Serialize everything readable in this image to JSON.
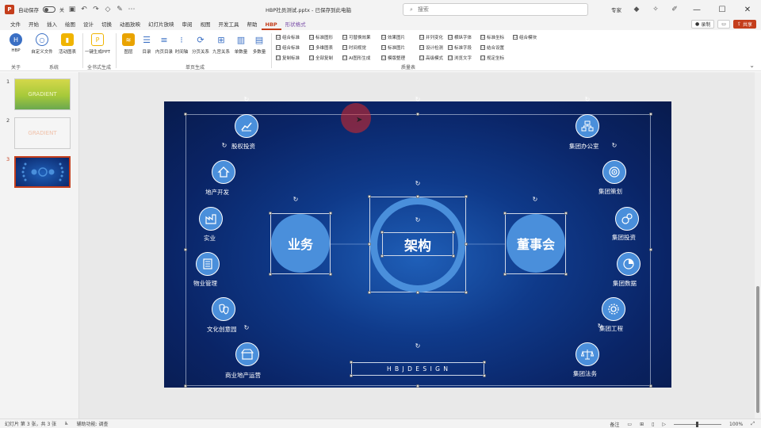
{
  "titlebar": {
    "autosave_label": "自动保存",
    "autosave_state": "关",
    "file_title": "HBP社员测试.pptx - 已保存到此电脑",
    "search_placeholder": "搜索",
    "user": "专家",
    "minimize": "—",
    "maximize": "☐",
    "close": "✕"
  },
  "menu": {
    "tabs": [
      "文件",
      "开始",
      "插入",
      "绘图",
      "设计",
      "切换",
      "动画放映",
      "幻灯片放映",
      "审阅",
      "视图",
      "开发工具",
      "帮助",
      "HBP",
      "形状格式"
    ],
    "active_index": 12,
    "context_index": 13,
    "record_label": "录制",
    "comment_icon": "comment-icon",
    "share_label": "共享"
  },
  "ribbon": {
    "groups": {
      "about": "关于",
      "tools": "系统",
      "generate": "全书式生成",
      "single": "单页生成",
      "checklist": "质量表"
    },
    "buttons": {
      "hbp": "HBP",
      "comment": "自定义文件",
      "inherit": "活动图表",
      "one_click": "一键生成PPT",
      "layer": "图层",
      "list": "目录",
      "list2": "内页目录",
      "cycle": "时间轴",
      "group": "分页关系",
      "grid": "九宫关系",
      "word": "单数量",
      "table": "多数量"
    },
    "checks": [
      "组合标准",
      "标准图形",
      "可替换效果",
      "效果图片",
      "并列变化",
      "横纵字体",
      "标准坐标",
      "组合模块",
      "组合标准",
      "多维图表",
      "时间视觉",
      "标准图片",
      "设计检测",
      "标准字段",
      "结合设置",
      "复制标准",
      "全部复制",
      "AI图形生成",
      "模版整理",
      "高级模式",
      "浏览文字",
      "规定坐标"
    ]
  },
  "thumbs": [
    {
      "num": "1",
      "text": "GRADIENT"
    },
    {
      "num": "2",
      "text": "GRADIENT"
    },
    {
      "num": "3",
      "text": ""
    }
  ],
  "slide": {
    "center_label": "架构",
    "left_label": "业务",
    "right_label": "董事会",
    "footer_text": "H B J D E S I G N",
    "left_items": [
      "股权投资",
      "地产开发",
      "实业",
      "物业管理",
      "文化创意园",
      "商业地产运营"
    ],
    "right_items": [
      "集团办公室",
      "集团策划",
      "集团投资",
      "集团数据",
      "集团工程",
      "集团法务"
    ],
    "icons_left": [
      "chart-icon",
      "house-icon",
      "factory-icon",
      "building-icon",
      "masks-icon",
      "mall-icon"
    ],
    "icons_right": [
      "org-icon",
      "target-icon",
      "coins-icon",
      "pie-icon",
      "gear-icon",
      "scale-icon"
    ],
    "accent": "#4a8fdb"
  },
  "statusbar": {
    "slide_info": "幻灯片 第 3 张，共 3 张",
    "accessibility": "辅助功能: 调查",
    "notes": "备注",
    "zoom": "100%"
  }
}
